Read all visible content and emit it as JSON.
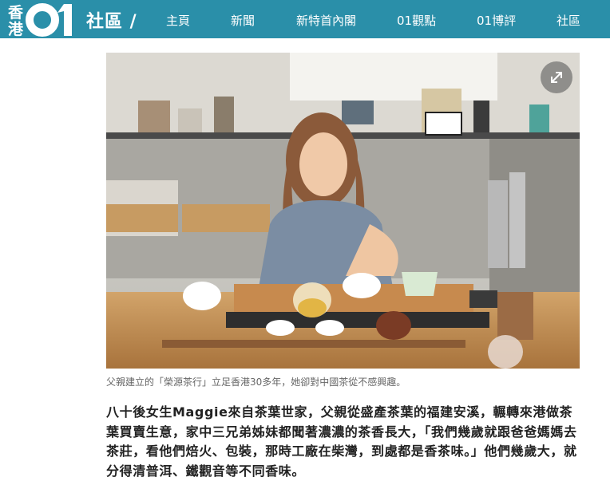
{
  "header": {
    "logo_text_line1": "香",
    "logo_text_line2": "港",
    "logo_number": "01",
    "section_title": "社區 /",
    "nav": [
      {
        "label": "主頁"
      },
      {
        "label": "新聞"
      },
      {
        "label": "新特首內閣"
      },
      {
        "label": "01觀點"
      },
      {
        "label": "01博評"
      },
      {
        "label": "社區"
      }
    ]
  },
  "article": {
    "image_caption": "父親建立的「榮源茶行」立足香港30多年，她卻對中國茶從不感興趣。",
    "expand_icon": "expand-arrows-icon",
    "paragraph": "八十後女生Maggie來自茶葉世家，父親從盛產茶葉的福建安溪，輾轉來港做茶葉買賣生意，家中三兄弟姊妹都聞著濃濃的茶香長大，「我們幾歲就跟爸爸媽媽去茶莊，看他們焙火、包裝，那時工廠在柴灣，到處都是香茶味。」他們幾歲大，就分得清普洱、鐵觀音等不同香味。"
  },
  "colors": {
    "topbar": "#2a8fa9",
    "text": "#222222",
    "caption": "#666666"
  }
}
